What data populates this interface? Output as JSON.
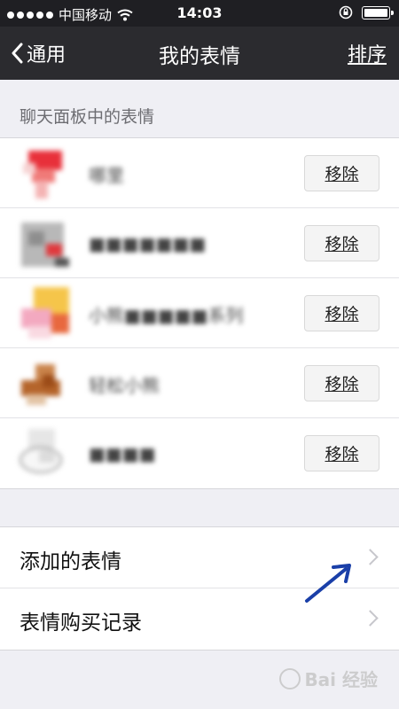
{
  "status_bar": {
    "carrier": "中国移动",
    "time": "14:03"
  },
  "nav": {
    "back_label": "通用",
    "title": "我的表情",
    "right_label": "排序"
  },
  "section": {
    "header": "聊天面板中的表情"
  },
  "stickers": [
    {
      "name": "哪里",
      "remove_label": "移除"
    },
    {
      "name": "■■■■■■■",
      "remove_label": "移除"
    },
    {
      "name": "小熊■■■■■系列",
      "remove_label": "移除"
    },
    {
      "name": "轻松小熊",
      "remove_label": "移除"
    },
    {
      "name": "■■■■",
      "remove_label": "移除"
    }
  ],
  "menu": [
    {
      "label": "添加的表情"
    },
    {
      "label": "表情购买记录"
    }
  ],
  "watermark": {
    "text": "Bai 经验"
  }
}
